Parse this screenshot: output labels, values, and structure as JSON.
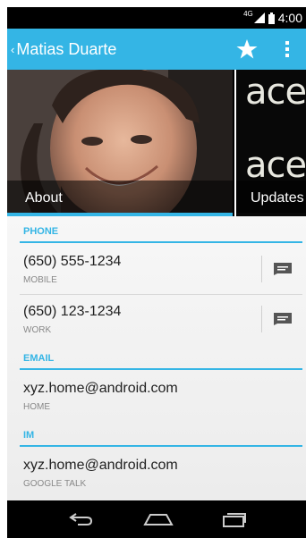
{
  "status": {
    "network": "4G",
    "time": "4:00"
  },
  "actionbar": {
    "back_caret": "‹",
    "title": "Matias Duarte",
    "star_icon": "star-icon",
    "overflow_icon": "overflow-menu-icon"
  },
  "tabs": [
    {
      "label": "About"
    },
    {
      "label": "Updates"
    }
  ],
  "updates_preview": {
    "text1": "ace",
    "text2": "ace"
  },
  "sections": {
    "phone": "PHONE",
    "email": "EMAIL",
    "im": "IM"
  },
  "phones": [
    {
      "number": "(650) 555-1234",
      "type": "MOBILE"
    },
    {
      "number": "(650) 123-1234",
      "type": "WORK"
    }
  ],
  "emails": [
    {
      "address": "xyz.home@android.com",
      "type": "HOME"
    }
  ],
  "ims": [
    {
      "handle": "xyz.home@android.com",
      "type": "GOOGLE TALK"
    }
  ],
  "colors": {
    "accent": "#34b5e5",
    "statusbar": "#000000",
    "navbar": "#000000"
  },
  "navbar": {
    "back_icon": "back-icon",
    "home_icon": "home-icon",
    "recents_icon": "recents-icon"
  }
}
